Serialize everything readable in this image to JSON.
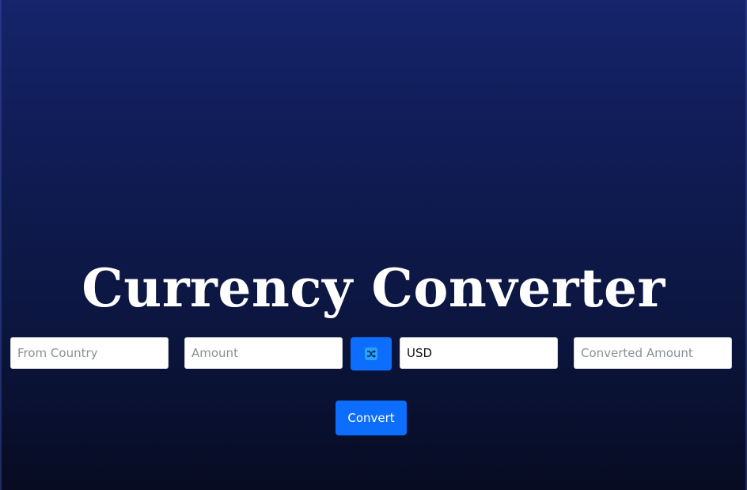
{
  "app": {
    "title": "Currency Converter"
  },
  "form": {
    "from_country": {
      "placeholder": "From Country",
      "value": ""
    },
    "amount": {
      "placeholder": "Amount",
      "value": ""
    },
    "swap": {
      "icon": "shuffle-icon"
    },
    "to_currency": {
      "placeholder": "",
      "value": "USD"
    },
    "converted_amount": {
      "placeholder": "Converted Amount",
      "value": ""
    },
    "convert_label": "Convert"
  },
  "colors": {
    "accent": "#0d6efd",
    "background_top": "#15246b",
    "background_bottom": "#070c22"
  }
}
